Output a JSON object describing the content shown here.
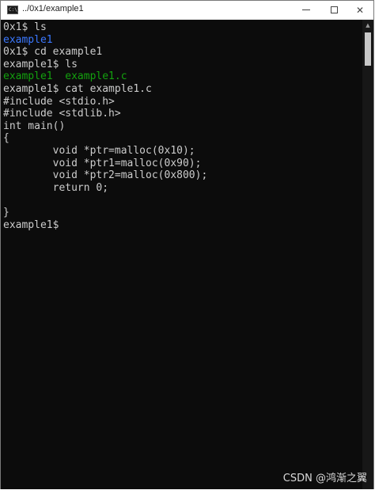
{
  "window": {
    "title": "../0x1/example1",
    "app_icon_text": "C:\\."
  },
  "terminal": {
    "lines": [
      {
        "text": "0x1$ ls",
        "color": "#cccccc"
      },
      {
        "text": "example1",
        "color": "#3b78ff"
      },
      {
        "text": "0x1$ cd example1",
        "color": "#cccccc"
      },
      {
        "text": "example1$ ls",
        "color": "#cccccc"
      },
      {
        "text": "example1  example1.c",
        "color": "#13a10e"
      },
      {
        "text": "example1$ cat example1.c",
        "color": "#cccccc"
      },
      {
        "text": "#include <stdio.h>",
        "color": "#cccccc"
      },
      {
        "text": "#include <stdlib.h>",
        "color": "#cccccc"
      },
      {
        "text": "int main()",
        "color": "#cccccc"
      },
      {
        "text": "{",
        "color": "#cccccc"
      },
      {
        "text": "        void *ptr=malloc(0x10);",
        "color": "#cccccc"
      },
      {
        "text": "        void *ptr1=malloc(0x90);",
        "color": "#cccccc"
      },
      {
        "text": "        void *ptr2=malloc(0x800);",
        "color": "#cccccc"
      },
      {
        "text": "        return 0;",
        "color": "#cccccc"
      },
      {
        "text": "",
        "color": "#cccccc"
      },
      {
        "text": "}",
        "color": "#cccccc"
      },
      {
        "text": "example1$",
        "color": "#cccccc"
      }
    ]
  },
  "controls": {
    "close_glyph": "✕"
  },
  "scrollbar": {
    "up_glyph": "▲"
  },
  "watermark": {
    "text": "CSDN @鸿渐之翼"
  },
  "colors": {
    "background": "#0c0c0c",
    "text": "#cccccc",
    "directory": "#3b78ff",
    "executable": "#13a10e"
  }
}
